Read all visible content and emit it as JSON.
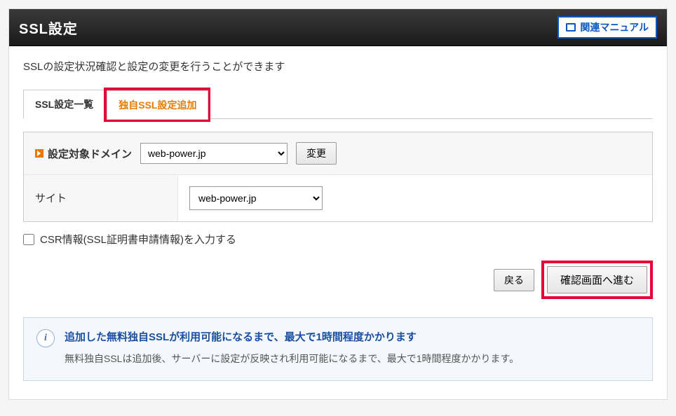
{
  "header": {
    "title": "SSL設定",
    "manual_link": "関連マニュアル"
  },
  "description": "SSLの設定状況確認と設定の変更を行うことができます",
  "tabs": {
    "list_tab": "SSL設定一覧",
    "add_tab": "独自SSL設定追加"
  },
  "form": {
    "target_domain_label": "設定対象ドメイン",
    "target_domain_value": "web-power.jp",
    "change_button": "変更",
    "site_label": "サイト",
    "site_value": "web-power.jp"
  },
  "csr_checkbox_label": "CSR情報(SSL証明書申請情報)を入力する",
  "buttons": {
    "back": "戻る",
    "confirm": "確認画面へ進む"
  },
  "info": {
    "icon_glyph": "i",
    "title": "追加した無料独自SSLが利用可能になるまで、最大で1時間程度かかります",
    "body": "無料独自SSLは追加後、サーバーに設定が反映され利用可能になるまで、最大で1時間程度かかります。"
  }
}
